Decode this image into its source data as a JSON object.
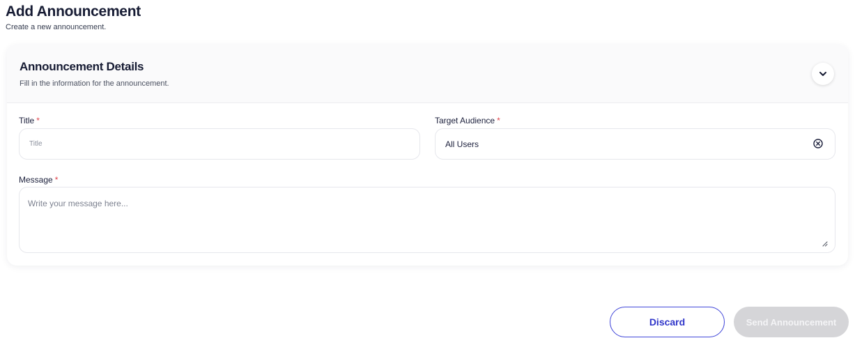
{
  "page": {
    "title": "Add Announcement",
    "subtitle": "Create a new announcement."
  },
  "section": {
    "title": "Announcement Details",
    "description": "Fill in the information for the announcement.",
    "collapse_icon": "chevron-down-icon"
  },
  "form": {
    "title_field": {
      "label": "Title",
      "required_mark": "*",
      "placeholder": "Title",
      "value": ""
    },
    "audience_field": {
      "label": "Target Audience",
      "required_mark": "*",
      "value": "All Users",
      "clear_icon": "clear-circle-icon"
    },
    "message_field": {
      "label": "Message",
      "required_mark": "*",
      "placeholder": "Write your message here...",
      "value": ""
    }
  },
  "actions": {
    "discard_label": "Discard",
    "send_label": "Send Announcement",
    "send_disabled": true
  },
  "colors": {
    "accent": "#3d43d8",
    "required": "#e0424a",
    "disabled_button": "#d5d5d8"
  }
}
